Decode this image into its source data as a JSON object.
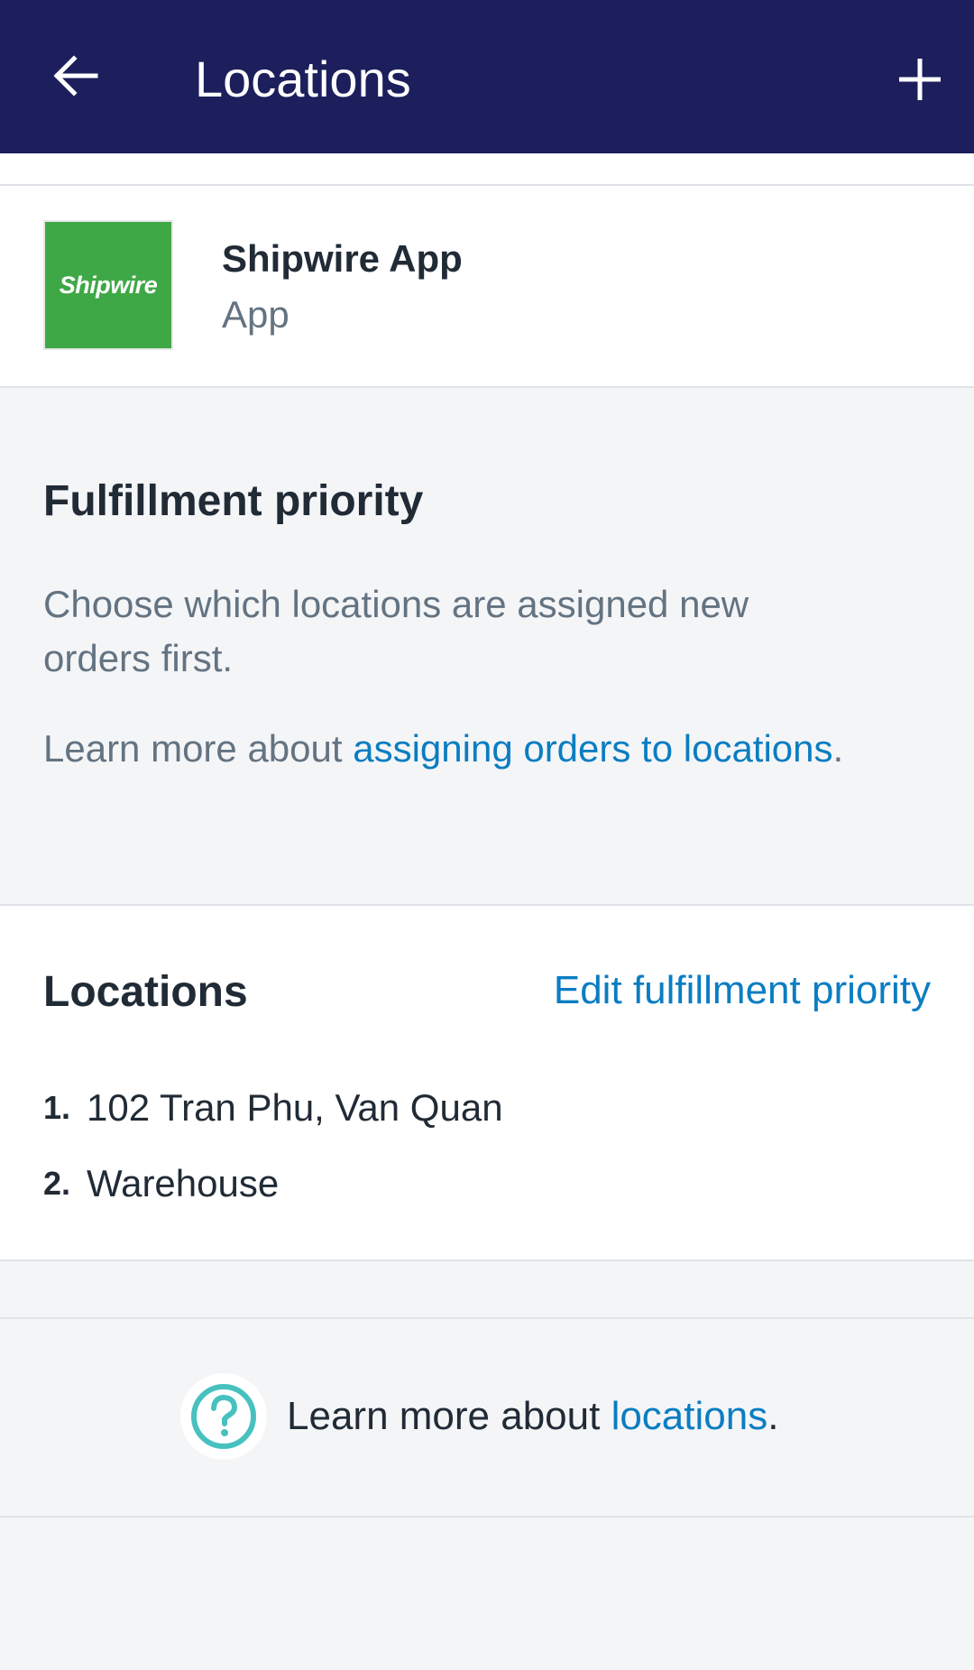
{
  "header": {
    "title": "Locations",
    "back_icon": "arrow-left-icon",
    "add_icon": "plus-icon"
  },
  "app": {
    "logo_text": "Shipwire",
    "name": "Shipwire App",
    "type": "App"
  },
  "fulfillment_priority": {
    "heading": "Fulfillment priority",
    "description": "Choose which locations are assigned new orders first.",
    "learn_prefix": "Learn more about ",
    "learn_link": "assigning orders to locations",
    "learn_suffix": "."
  },
  "locations": {
    "heading": "Locations",
    "edit_link": "Edit fulfillment priority",
    "items": [
      {
        "number": "1.",
        "name": "102 Tran Phu, Van Quan"
      },
      {
        "number": "2.",
        "name": "Warehouse"
      }
    ]
  },
  "footer": {
    "help_icon": "help-circle-icon",
    "prefix": "Learn more about ",
    "link": "locations",
    "suffix": "."
  },
  "colors": {
    "header_bg": "#1c1f5c",
    "link": "#0a7dc2",
    "logo_bg": "#3fa846",
    "help_icon": "#47c1bf"
  }
}
